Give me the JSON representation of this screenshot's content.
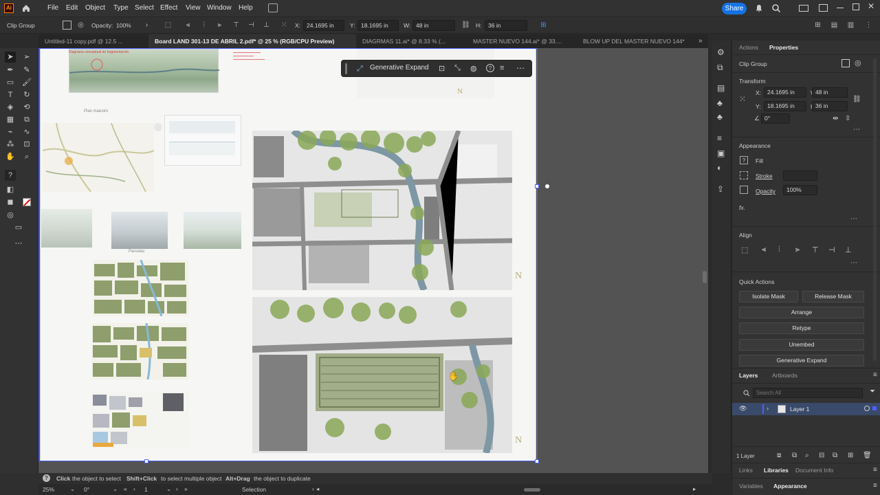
{
  "menubar": {
    "logo": "Ai",
    "menus": [
      "File",
      "Edit",
      "Object",
      "Type",
      "Select",
      "Effect",
      "View",
      "Window",
      "Help"
    ],
    "share_label": "Share",
    "icons": [
      "home-icon",
      "workspace-icon",
      "bell-icon",
      "search-icon",
      "grid-icon",
      "window-icon",
      "minimize-icon",
      "maximize-icon",
      "close-icon"
    ]
  },
  "controlbar": {
    "selection_label": "Clip Group",
    "opacity_label": "Opacity:",
    "opacity_value": "100%",
    "x_label": "X:",
    "x_value": "24.1695 in",
    "y_label": "Y:",
    "y_value": "18.1695 in",
    "w_label": "W:",
    "w_value": "48 in",
    "h_label": "H:",
    "h_value": "36 in"
  },
  "tabs": [
    {
      "label": "Untitled-11 copy.pdf @ 12.5 ..."
    },
    {
      "label": "Board LAND 301-13 DE ABRIL 2.pdf* @ 25 % (RGB/CPU Preview)"
    },
    {
      "label": "DIAGRMAS 11.ai* @ 8.33 % (..."
    },
    {
      "label": "MASTER NUEVO 144.ai* @ 33...."
    },
    {
      "label": "BLOW UP DEL MASTER NUEVO 144*"
    }
  ],
  "genbar": {
    "label": "Generative Expand"
  },
  "artboard_texts": {
    "diag_title": "Diagrama conceptual de fragmentación",
    "plan_label": "Plan maestro",
    "parcelas_label": "Parcelas",
    "north_1": "N",
    "north_2": "N",
    "north_3": "N"
  },
  "right_panel": {
    "tabs": [
      "Actions",
      "Properties"
    ],
    "active_tab": "Properties",
    "object_type": "Clip Group",
    "transform": {
      "title": "Transform",
      "x_label": "X:",
      "x_value": "24.1695 in",
      "w_label": "W:",
      "w_value": "48 in",
      "y_label": "Y:",
      "y_value": "18.1695 in",
      "h_label": "H:",
      "h_value": "36 in",
      "angle_value": "0°"
    },
    "appearance": {
      "title": "Appearance",
      "fill_label": "Fill",
      "stroke_label": "Stroke",
      "opacity_label": "Opacity",
      "opacity_value": "100%",
      "fx_label": "fx."
    },
    "align": {
      "title": "Align"
    },
    "quick_actions": {
      "title": "Quick Actions",
      "isolate_mask": "Isolate Mask",
      "release_mask": "Release Mask",
      "arrange": "Arrange",
      "retype": "Retype",
      "unembed": "Unembed",
      "generative_expand": "Generative Expand"
    },
    "layers": {
      "tabs": [
        "Layers",
        "Artboards"
      ],
      "search_placeholder": "Search All",
      "layer_name": "Layer 1",
      "count_label": "1 Layer"
    },
    "bottom_tabs_1": [
      "Links",
      "Libraries",
      "Document Info"
    ],
    "bottom_tabs_2": [
      "Variables",
      "Appearance"
    ]
  },
  "statusbar": {
    "hint_1": "Click",
    "hint_1b": "the object to select",
    "hint_2": "Shift+Click",
    "hint_2b": "to select multiple object",
    "hint_3": "Alt+Drag",
    "hint_3b": "the object to duplicate",
    "zoom_value": "25%",
    "rotation_value": "0°",
    "artboard_number": "1",
    "tool_name": "Selection"
  },
  "colors": {
    "accent": "#1473e6",
    "selection": "#4a62ff",
    "panel_bg": "#323232",
    "canvas_bg": "#535353"
  }
}
